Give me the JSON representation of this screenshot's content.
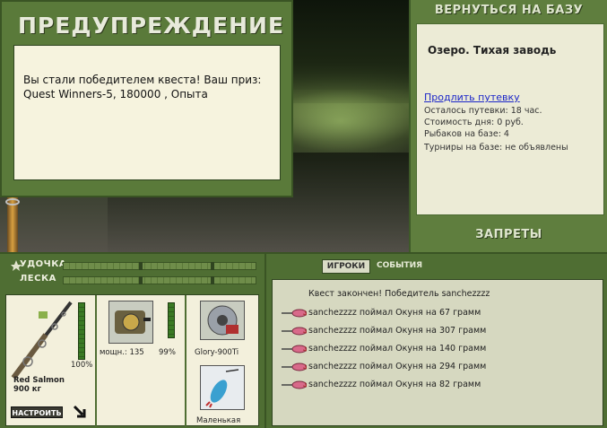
{
  "warning": {
    "title": "ПРЕДУПРЕЖДЕНИЕ",
    "line1": "Вы стали победителем квеста! Ваш приз:",
    "line2": "Quest Winners-5, 180000 , Опыта"
  },
  "base": {
    "return_label": "ВЕРНУТЬСЯ НА БАЗУ",
    "lake": "Озеро. Тихая заводь",
    "extend_link": "Продлить путевку",
    "permit_left": "Осталось путевки: 18 час.",
    "day_cost": "Стоимость дня: 0 руб.",
    "fishers": "Рыбаков на базе: 4",
    "tournaments": "Турниры на базе: не объявлены",
    "bans_label": "ЗАПРЕТЫ"
  },
  "tackle": {
    "rod_label": "УДОЧКА",
    "line_label": "ЛЕСКА",
    "rod_name": "Red Salmon",
    "rod_weight": "900 кг",
    "rod_condition": "100%",
    "reel_power": "мощн.: 135",
    "reel_condition": "99%",
    "line_name": "Glory-900Ti",
    "lure_name": "Маленькая",
    "setup_label": "НАСТРОИТЬ"
  },
  "events": {
    "tab_players": "ИГРОКИ",
    "tab_events": "СОБЫТИЯ",
    "header": "Квест закончен! Победитель sanchezzzz",
    "items": [
      "sanchezzzz поймал Окуня на 67 грамм",
      "sanchezzzz поймал Окуня на 307 грамм",
      "sanchezzzz поймал Окуня на 140 грамм",
      "sanchezzzz поймал Окуня на 294 грамм",
      "sanchezzzz поймал Окуня на 82 грамм"
    ]
  },
  "colors": {
    "panel_green": "#5f7e3e",
    "dialog_bg": "#f6f3de",
    "link_blue": "#1b25c8"
  }
}
